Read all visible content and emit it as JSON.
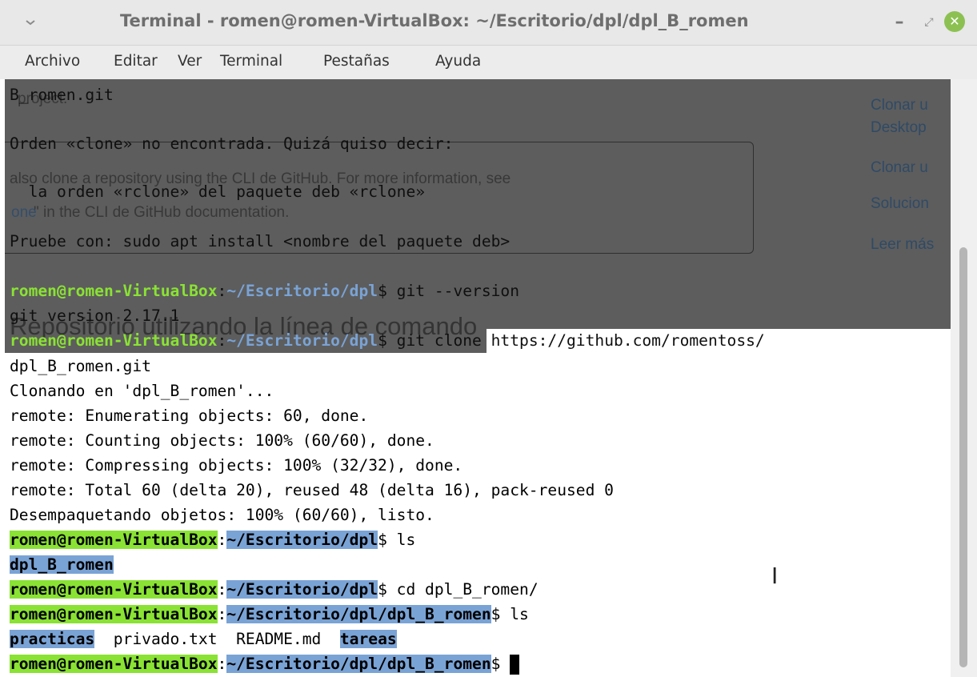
{
  "window": {
    "title": "Terminal - romen@romen-VirtualBox: ~/Escritorio/dpl/dpl_B_romen",
    "minimize": "–",
    "maximize": "⤢",
    "close": "✕"
  },
  "menu": [
    "Archivo",
    "Editar",
    "Ver",
    "Terminal",
    "Pestañas",
    "Ayuda"
  ],
  "background_page": {
    "frag1": "project.",
    "frag2": "also clone a repository using the CLI de GitHub. For more information, see",
    "frag3": "one",
    "frag4": " \" in the CLI de GitHub documentation.",
    "heading": "Repositorio utilizando la línea de comando",
    "links": [
      "Clonar u",
      "Desktop",
      "Clonar u",
      "Solucion",
      "Leer más"
    ]
  },
  "terminal": {
    "user_host": "romen@romen-VirtualBox",
    "lines": {
      "l1": "B_romen.git",
      "l2": "Orden «clone» no encontrada. Quizá quiso decir:",
      "l3": "  la orden «rclone» del paquete deb «rclone»",
      "l4": "Pruebe con: sudo apt install <nombre del paquete deb>",
      "l5_path": "~/Escritorio/dpl",
      "l5_cmd": "$ git --version",
      "l6": "git version 2.17.1",
      "l7_path": "~/Escritorio/dpl",
      "l7_cmd": "$ git clone https://github.com/romentoss/",
      "l8": "dpl_B_romen.git",
      "l9": "Clonando en 'dpl_B_romen'...",
      "l10": "remote: Enumerating objects: 60, done.",
      "l11": "remote: Counting objects: 100% (60/60), done.",
      "l12": "remote: Compressing objects: 100% (32/32), done.",
      "l13": "remote: Total 60 (delta 20), reused 48 (delta 16), pack-reused 0",
      "l14": "Desempaquetando objetos: 100% (60/60), listo.",
      "l15_path": "~/Escritorio/dpl",
      "l15_cmd": "$ ls",
      "l16": "dpl_B_romen",
      "l17_path": "~/Escritorio/dpl",
      "l17_cmd": "$ cd dpl_B_romen/",
      "l18_path": "~/Escritorio/dpl/dpl_B_romen",
      "l18_cmd": "$ ls",
      "l19_dir1": "practicas",
      "l19_mid": "  privado.txt  README.md  ",
      "l19_dir2": "tareas",
      "l20_path": "~/Escritorio/dpl/dpl_B_romen",
      "l20_cmd": "$ "
    }
  },
  "colors": {
    "user": "#8ae234",
    "path": "#7aa3d5",
    "close_button": "#8cc152"
  }
}
